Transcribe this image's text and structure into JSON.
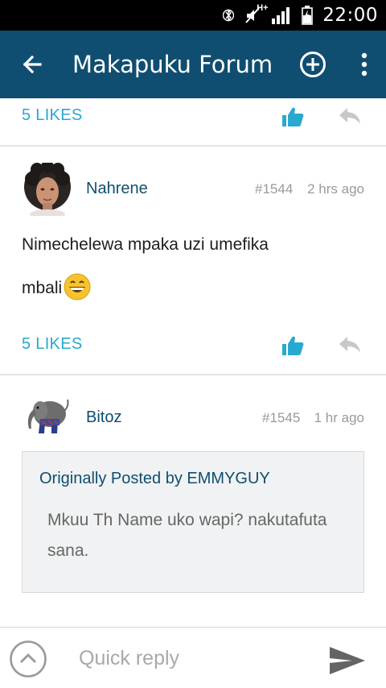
{
  "status_bar": {
    "time": "22:00",
    "network": "H+"
  },
  "app_bar": {
    "title": "Makapuku Forum"
  },
  "posts": [
    {
      "likes": "5 LIKES"
    },
    {
      "username": "Nahrene",
      "post_number": "#1544",
      "time": "2 hrs ago",
      "message_line1": "Nimechelewa mpaka uzi umefika",
      "message_line2": "mbali",
      "likes": "5 LIKES"
    },
    {
      "username": "Bitoz",
      "post_number": "#1545",
      "time": "1 hr ago",
      "quote_header": "Originally Posted by EMMYGUY",
      "quote_text": "Mkuu Th Name uko wapi? nakutafuta sana."
    }
  ],
  "quick_reply": {
    "placeholder": "Quick reply"
  },
  "colors": {
    "app_bar": "#0f4e70",
    "accent": "#29a8d0",
    "username": "#0f4e70"
  }
}
